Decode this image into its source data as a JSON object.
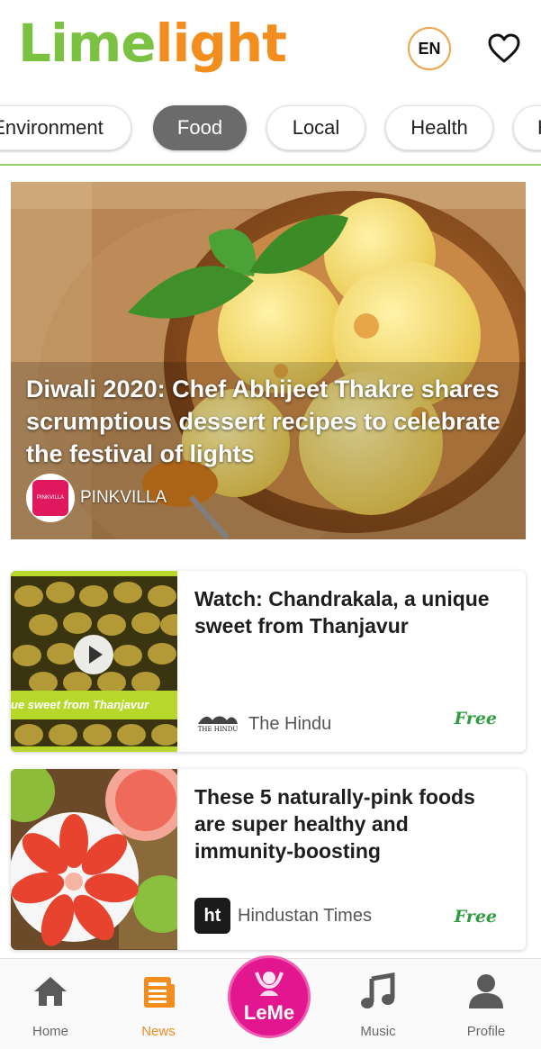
{
  "header": {
    "logo_part1": "Lime",
    "logo_part2": "light",
    "language_button": "EN",
    "favorites_icon": "heart-icon"
  },
  "categories": [
    {
      "label": "Environment",
      "active": false
    },
    {
      "label": "Food",
      "active": true
    },
    {
      "label": "Local",
      "active": false
    },
    {
      "label": "Health",
      "active": false
    },
    {
      "label": "H",
      "active": false
    }
  ],
  "hero": {
    "title": "Diwali 2020: Chef Abhijeet Thakre shares scrumptious dessert recipes to celebrate the festival of lights",
    "source": "PINKVILLA",
    "source_logo_text": "PINKVILLA"
  },
  "articles": [
    {
      "title": "Watch: Chandrakala, a unique sweet from Thanjavur",
      "source": "The Hindu",
      "source_logo_text": "THE HINDU",
      "badge": "Free",
      "thumb_caption": "ue sweet from Thanjavur",
      "is_video": true
    },
    {
      "title": "These 5 naturally-pink foods are super healthy and immunity-boosting",
      "source": "Hindustan Times",
      "source_logo_text": "ht",
      "badge": "Free",
      "is_video": false
    }
  ],
  "tabbar": {
    "items": [
      {
        "label": "Home",
        "icon": "home-icon",
        "active": false
      },
      {
        "label": "News",
        "icon": "news-icon",
        "active": true
      },
      {
        "label": "LeMe",
        "icon": "leme-icon",
        "active": false
      },
      {
        "label": "Music",
        "icon": "music-note-icon",
        "active": false
      },
      {
        "label": "Profile",
        "icon": "profile-icon",
        "active": false
      }
    ]
  },
  "colors": {
    "brand_green": "#7cc242",
    "brand_orange": "#f28d1e",
    "leme_pink": "#e2178f",
    "free_green": "#2e9c3f"
  }
}
